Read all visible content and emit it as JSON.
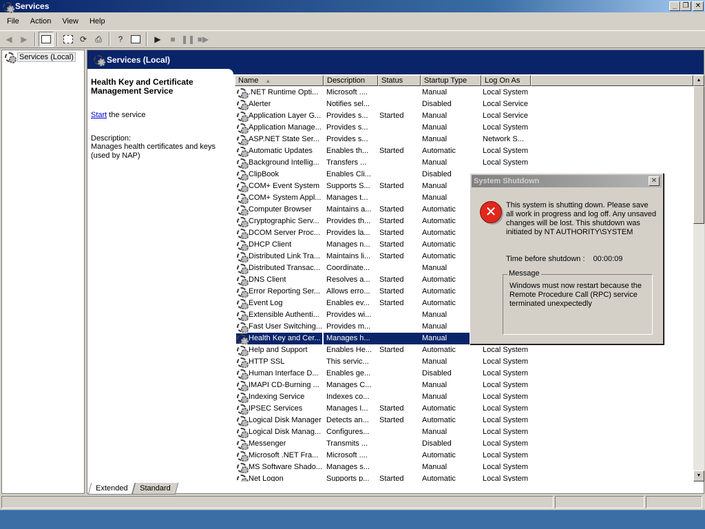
{
  "window": {
    "title": "Services"
  },
  "window_buttons": {
    "minimize": "_",
    "maximize": "❐",
    "close": "✕"
  },
  "menu": [
    "File",
    "Action",
    "View",
    "Help"
  ],
  "tree": {
    "root": "Services (Local)"
  },
  "pane": {
    "title": "Services (Local)"
  },
  "details": {
    "service_name": "Health Key and Certificate Management Service",
    "action_link": "Start",
    "action_suffix": " the service",
    "description_label": "Description:",
    "description": "Manages health certificates and keys (used by NAP)"
  },
  "columns": {
    "name": "Name",
    "description": "Description",
    "status": "Status",
    "startup": "Startup Type",
    "logon": "Log On As"
  },
  "services": [
    {
      "name": ".NET Runtime Opti...",
      "desc": "Microsoft ....",
      "status": "",
      "startup": "Manual",
      "logon": "Local System"
    },
    {
      "name": "Alerter",
      "desc": "Notifies sel...",
      "status": "",
      "startup": "Disabled",
      "logon": "Local Service"
    },
    {
      "name": "Application Layer G...",
      "desc": "Provides s...",
      "status": "Started",
      "startup": "Manual",
      "logon": "Local Service"
    },
    {
      "name": "Application Manage...",
      "desc": "Provides s...",
      "status": "",
      "startup": "Manual",
      "logon": "Local System"
    },
    {
      "name": "ASP.NET State Ser...",
      "desc": "Provides s...",
      "status": "",
      "startup": "Manual",
      "logon": "Network S..."
    },
    {
      "name": "Automatic Updates",
      "desc": "Enables th...",
      "status": "Started",
      "startup": "Automatic",
      "logon": "Local System"
    },
    {
      "name": "Background Intellig...",
      "desc": "Transfers ...",
      "status": "",
      "startup": "Manual",
      "logon": "Local System"
    },
    {
      "name": "ClipBook",
      "desc": "Enables Cli...",
      "status": "",
      "startup": "Disabled",
      "logon": ""
    },
    {
      "name": "COM+ Event System",
      "desc": "Supports S...",
      "status": "Started",
      "startup": "Manual",
      "logon": ""
    },
    {
      "name": "COM+ System Appl...",
      "desc": "Manages t...",
      "status": "",
      "startup": "Manual",
      "logon": ""
    },
    {
      "name": "Computer Browser",
      "desc": "Maintains a...",
      "status": "Started",
      "startup": "Automatic",
      "logon": ""
    },
    {
      "name": "Cryptographic Serv...",
      "desc": "Provides th...",
      "status": "Started",
      "startup": "Automatic",
      "logon": ""
    },
    {
      "name": "DCOM Server Proc...",
      "desc": "Provides la...",
      "status": "Started",
      "startup": "Automatic",
      "logon": ""
    },
    {
      "name": "DHCP Client",
      "desc": "Manages n...",
      "status": "Started",
      "startup": "Automatic",
      "logon": ""
    },
    {
      "name": "Distributed Link Tra...",
      "desc": "Maintains li...",
      "status": "Started",
      "startup": "Automatic",
      "logon": ""
    },
    {
      "name": "Distributed Transac...",
      "desc": "Coordinate...",
      "status": "",
      "startup": "Manual",
      "logon": ""
    },
    {
      "name": "DNS Client",
      "desc": "Resolves a...",
      "status": "Started",
      "startup": "Automatic",
      "logon": ""
    },
    {
      "name": "Error Reporting Ser...",
      "desc": "Allows erro...",
      "status": "Started",
      "startup": "Automatic",
      "logon": ""
    },
    {
      "name": "Event Log",
      "desc": "Enables ev...",
      "status": "Started",
      "startup": "Automatic",
      "logon": ""
    },
    {
      "name": "Extensible Authenti...",
      "desc": "Provides wi...",
      "status": "",
      "startup": "Manual",
      "logon": ""
    },
    {
      "name": "Fast User Switching...",
      "desc": "Provides m...",
      "status": "",
      "startup": "Manual",
      "logon": ""
    },
    {
      "name": "Health Key and Cer...",
      "desc": "Manages h...",
      "status": "",
      "startup": "Manual",
      "logon": "",
      "selected": true
    },
    {
      "name": "Help and Support",
      "desc": "Enables He...",
      "status": "Started",
      "startup": "Automatic",
      "logon": "Local System"
    },
    {
      "name": "HTTP SSL",
      "desc": "This servic...",
      "status": "",
      "startup": "Manual",
      "logon": "Local System"
    },
    {
      "name": "Human Interface D...",
      "desc": "Enables ge...",
      "status": "",
      "startup": "Disabled",
      "logon": "Local System"
    },
    {
      "name": "IMAPI CD-Burning ...",
      "desc": "Manages C...",
      "status": "",
      "startup": "Manual",
      "logon": "Local System"
    },
    {
      "name": "Indexing Service",
      "desc": "Indexes co...",
      "status": "",
      "startup": "Manual",
      "logon": "Local System"
    },
    {
      "name": "IPSEC Services",
      "desc": "Manages I...",
      "status": "Started",
      "startup": "Automatic",
      "logon": "Local System"
    },
    {
      "name": "Logical Disk Manager",
      "desc": "Detects an...",
      "status": "Started",
      "startup": "Automatic",
      "logon": "Local System"
    },
    {
      "name": "Logical Disk Manag...",
      "desc": "Configures...",
      "status": "",
      "startup": "Manual",
      "logon": "Local System"
    },
    {
      "name": "Messenger",
      "desc": "Transmits ...",
      "status": "",
      "startup": "Disabled",
      "logon": "Local System"
    },
    {
      "name": "Microsoft .NET Fra...",
      "desc": "Microsoft ....",
      "status": "",
      "startup": "Automatic",
      "logon": "Local System"
    },
    {
      "name": "MS Software Shado...",
      "desc": "Manages s...",
      "status": "",
      "startup": "Manual",
      "logon": "Local System"
    },
    {
      "name": "Net Logon",
      "desc": "Supports p...",
      "status": "Started",
      "startup": "Automatic",
      "logon": "Local System"
    }
  ],
  "tabs": {
    "extended": "Extended",
    "standard": "Standard"
  },
  "dialog": {
    "title": "System Shutdown",
    "close": "✕",
    "icon": "✕",
    "message": "This system is shutting down. Please save all work in progress and log off. Any unsaved changes will be lost. This shutdown was initiated by NT AUTHORITY\\SYSTEM",
    "time_label": "Time before shutdown :",
    "time_value": "00:00:09",
    "group_label": "Message",
    "group_text": "Windows must now restart because the Remote Procedure Call (RPC) service terminated unexpectedly"
  }
}
